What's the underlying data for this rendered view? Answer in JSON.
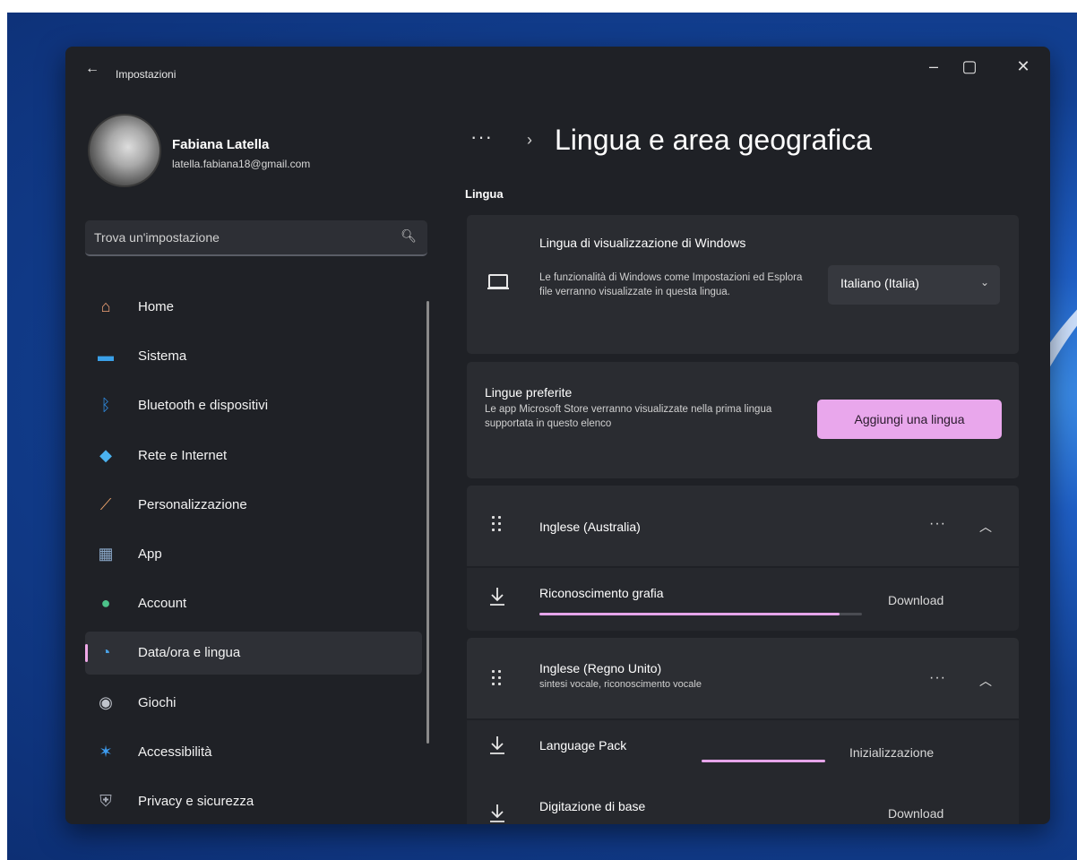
{
  "window": {
    "title": "Impostazioni",
    "back": "←",
    "controls": {
      "minimize": "–",
      "maximize": "▢",
      "close": "✕"
    }
  },
  "user": {
    "name": "Fabiana Latella",
    "email": "latella.fabiana18@gmail.com"
  },
  "search": {
    "placeholder": "Trova un'impostazione",
    "icon": "search-icon"
  },
  "sidebar": {
    "items": [
      {
        "label": "Home",
        "icon": "home-icon",
        "color": "#f1a277",
        "glyph": "⌂"
      },
      {
        "label": "Sistema",
        "icon": "monitor-icon",
        "color": "#3aa0e8",
        "glyph": "▬"
      },
      {
        "label": "Bluetooth e dispositivi",
        "icon": "bluetooth-icon",
        "color": "#2f8ee6",
        "glyph": "ᛒ"
      },
      {
        "label": "Rete e Internet",
        "icon": "wifi-icon",
        "color": "#4bb2ef",
        "glyph": "◆"
      },
      {
        "label": "Personalizzazione",
        "icon": "brush-icon",
        "color": "#e8a16a",
        "glyph": "⟋"
      },
      {
        "label": "App",
        "icon": "apps-icon",
        "color": "#8aa8c8",
        "glyph": "▦"
      },
      {
        "label": "Account",
        "icon": "account-icon",
        "color": "#4cc38a",
        "glyph": "●"
      },
      {
        "label": "Data/ora e lingua",
        "icon": "globe-clock-icon",
        "color": "#4aa3e8",
        "glyph": "◔",
        "active": true
      },
      {
        "label": "Giochi",
        "icon": "gamepad-icon",
        "color": "#c0c4cc",
        "glyph": "◉"
      },
      {
        "label": "Accessibilità",
        "icon": "accessibility-icon",
        "color": "#3d9cf0",
        "glyph": "✶"
      },
      {
        "label": "Privacy e sicurezza",
        "icon": "shield-icon",
        "color": "#a8adb8",
        "glyph": "⛨"
      }
    ]
  },
  "breadcrumb": {
    "more": "···",
    "separator": "›"
  },
  "page": {
    "title": "Lingua e area geografica"
  },
  "section": {
    "label": "Lingua"
  },
  "display_language": {
    "title": "Lingua di visualizzazione di Windows",
    "description": "Le funzionalità di Windows come Impostazioni ed Esplora file verranno visualizzate in questa lingua.",
    "selected": "Italiano (Italia)",
    "chevron": "⌄"
  },
  "preferred_languages": {
    "title": "Lingue preferite",
    "description": "Le app Microsoft Store verranno visualizzate nella prima lingua supportata in questo elenco",
    "add_button": "Aggiungi una lingua"
  },
  "languages": [
    {
      "name": "Inglese (Australia)",
      "subtitle": "",
      "more": "···",
      "chevron": "︿",
      "features": [
        {
          "label": "Riconoscimento grafia",
          "status": "Download",
          "progress": 0.93
        }
      ]
    },
    {
      "name": "Inglese (Regno Unito)",
      "subtitle": "sintesi vocale, riconoscimento vocale",
      "more": "···",
      "chevron": "︿",
      "features": [
        {
          "label": "Language Pack",
          "status": "Inizializzazione",
          "progress": 1.0
        },
        {
          "label": "Digitazione di base",
          "status": "Download"
        }
      ]
    }
  ],
  "colors": {
    "accent": "#e9a7ec",
    "window_bg": "#1f2126",
    "card_bg": "#2a2c31"
  }
}
